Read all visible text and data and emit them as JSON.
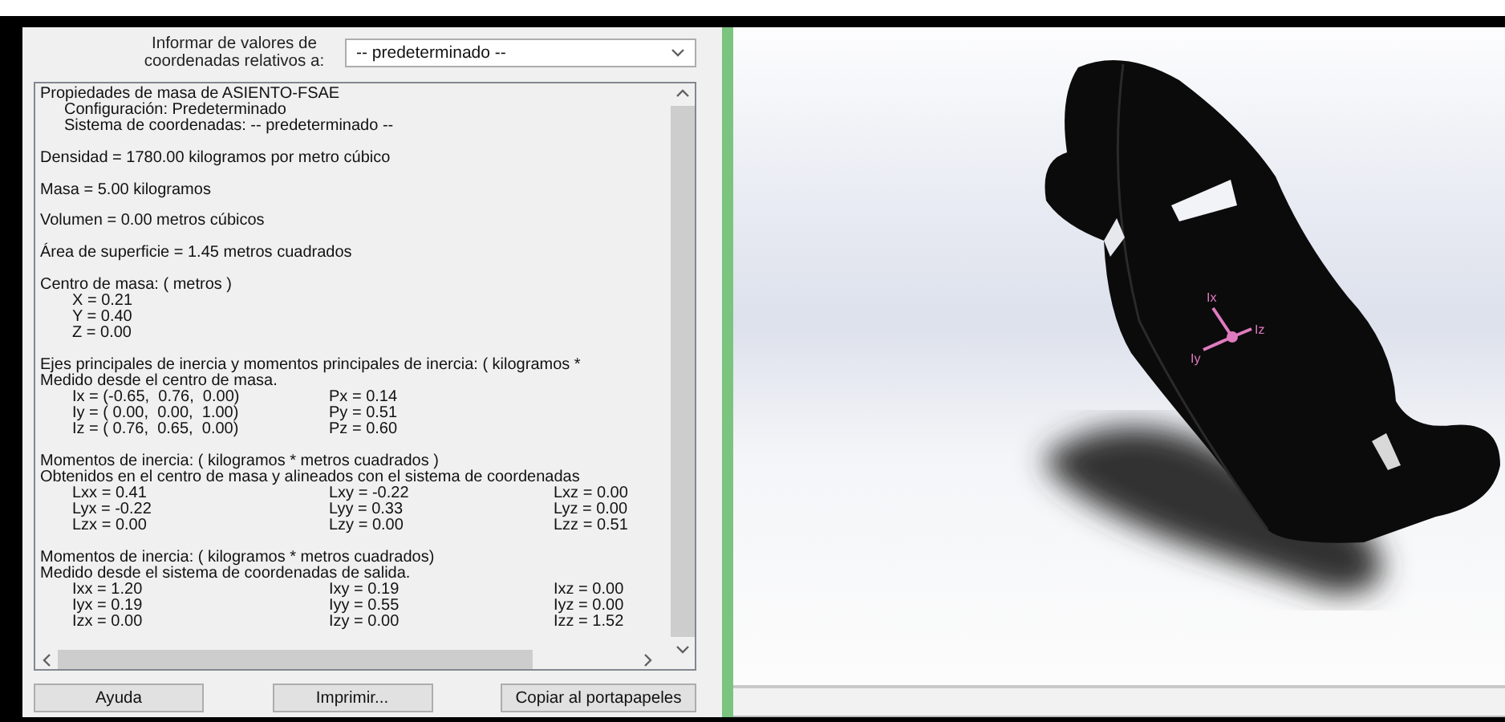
{
  "options_label": "Informar de valores de coordenadas relativos a:",
  "coordinate_system": {
    "value": "-- predeterminado --"
  },
  "report": {
    "blocks": [
      {
        "lines": [
          {
            "kind": "plain",
            "text": "Propiedades de masa de ASIENTO-FSAE"
          },
          {
            "kind": "sub",
            "text": "Configuración:  Predeterminado"
          },
          {
            "kind": "sub",
            "text": "Sistema de coordenadas:  -- predeterminado --"
          }
        ]
      },
      {
        "lines": [
          {
            "kind": "plain",
            "text": "Densidad = 1780.00 kilogramos por metro cúbico"
          }
        ]
      },
      {
        "lines": [
          {
            "kind": "plain",
            "text": "Masa = 5.00 kilogramos"
          }
        ]
      },
      {
        "lines": [
          {
            "kind": "plain",
            "text": "Volumen = 0.00 metros cúbicos"
          }
        ]
      },
      {
        "lines": [
          {
            "kind": "plain",
            "text": "Área de superficie = 1.45 metros cuadrados"
          }
        ]
      },
      {
        "lines": [
          {
            "kind": "plain",
            "text": "Centro de masa: ( metros )"
          },
          {
            "kind": "values",
            "cells": [
              "X = 0.21"
            ]
          },
          {
            "kind": "values",
            "cells": [
              "Y = 0.40"
            ]
          },
          {
            "kind": "values",
            "cells": [
              "Z = 0.00"
            ]
          }
        ]
      },
      {
        "lines": [
          {
            "kind": "plain",
            "text": "Ejes principales de inercia y momentos principales de inercia: ( kilogramos *"
          },
          {
            "kind": "plain",
            "text": "Medido desde el centro de masa."
          },
          {
            "kind": "values",
            "cells": [
              "Ix = (-0.65,  0.76,  0.00)",
              "Px = 0.14"
            ]
          },
          {
            "kind": "values",
            "cells": [
              "Iy = ( 0.00,  0.00,  1.00)",
              "Py = 0.51"
            ]
          },
          {
            "kind": "values",
            "cells": [
              "Iz = ( 0.76,  0.65,  0.00)",
              "Pz = 0.60"
            ]
          }
        ]
      },
      {
        "lines": [
          {
            "kind": "plain",
            "text": "Momentos de inercia: ( kilogramos * metros cuadrados )"
          },
          {
            "kind": "plain",
            "text": "Obtenidos en el centro de masa y alineados con el sistema de coordenadas"
          },
          {
            "kind": "values",
            "cells": [
              "Lxx = 0.41",
              "Lxy = -0.22",
              "Lxz = 0.00"
            ]
          },
          {
            "kind": "values",
            "cells": [
              "Lyx = -0.22",
              "Lyy = 0.33",
              "Lyz = 0.00"
            ]
          },
          {
            "kind": "values",
            "cells": [
              "Lzx = 0.00",
              "Lzy = 0.00",
              "Lzz = 0.51"
            ]
          }
        ]
      },
      {
        "lines": [
          {
            "kind": "plain",
            "text": "Momentos de inercia: ( kilogramos * metros cuadrados)"
          },
          {
            "kind": "plain",
            "text": "Medido desde el sistema de coordenadas de salida."
          },
          {
            "kind": "values",
            "cells": [
              "Ixx = 1.20",
              "Ixy = 0.19",
              "Ixz = 0.00"
            ]
          },
          {
            "kind": "values",
            "cells": [
              "Iyx = 0.19",
              "Iyy = 0.55",
              "Iyz = 0.00"
            ]
          },
          {
            "kind": "values",
            "cells": [
              "Izx = 0.00",
              "Izy = 0.00",
              "Izz = 1.52"
            ]
          }
        ]
      }
    ]
  },
  "buttons": [
    "Ayuda",
    "Imprimir...",
    "Copiar al portapapeles"
  ],
  "viewport": {
    "axis_labels": [
      "Ix",
      "Iy",
      "Iz"
    ]
  }
}
